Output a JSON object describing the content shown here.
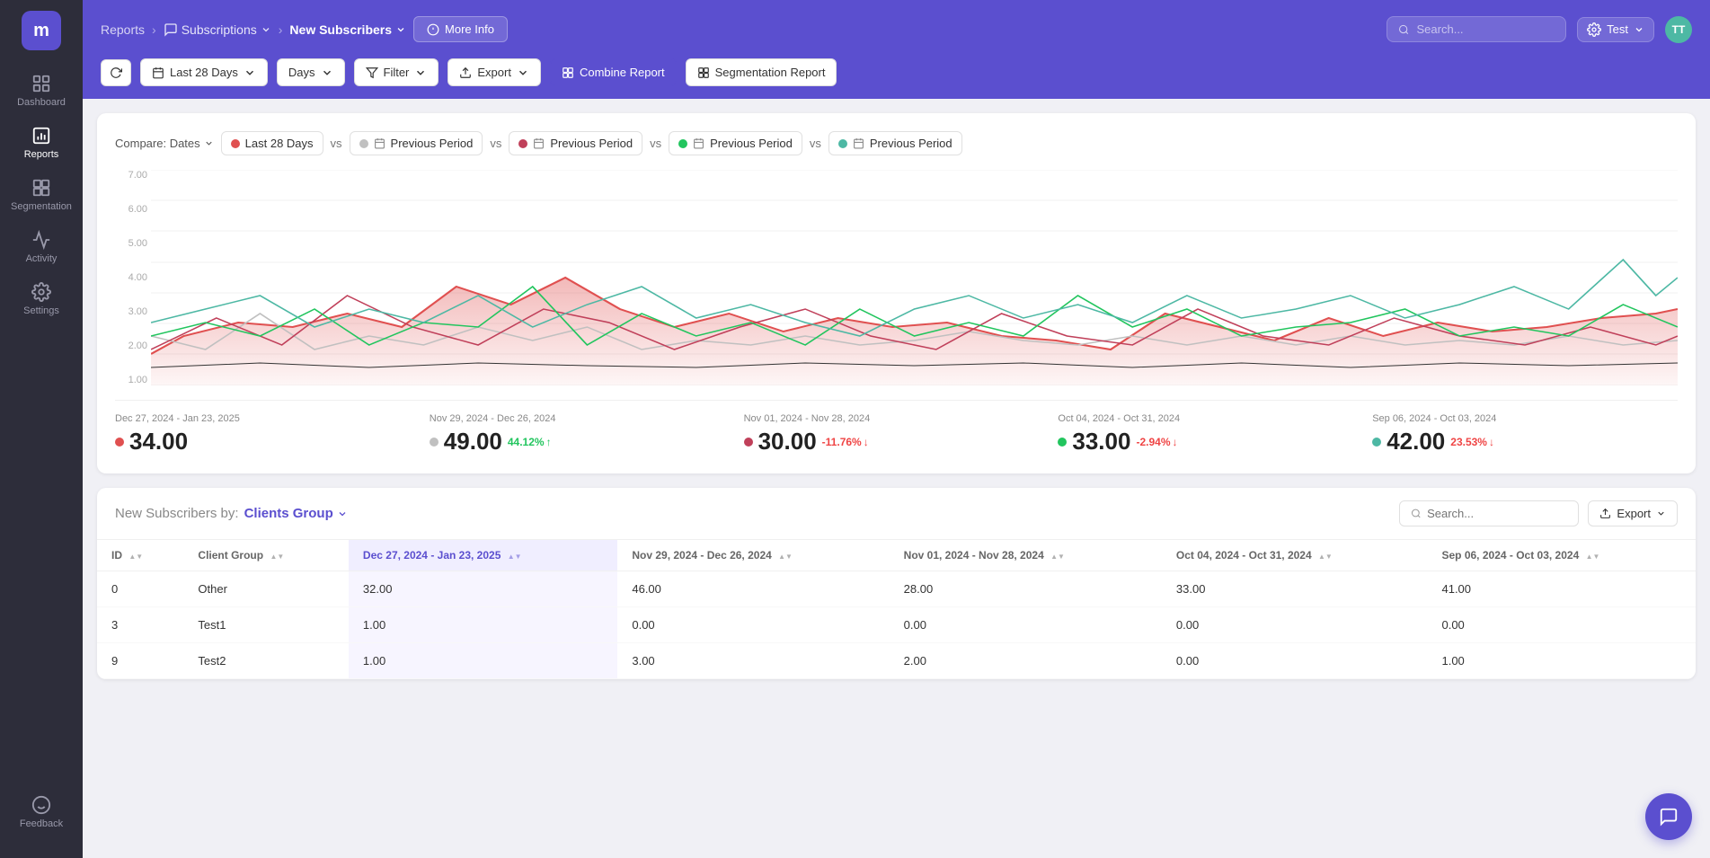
{
  "sidebar": {
    "logo": "m",
    "items": [
      {
        "id": "dashboard",
        "label": "Dashboard",
        "icon": "dashboard"
      },
      {
        "id": "reports",
        "label": "Reports",
        "icon": "reports",
        "active": true
      },
      {
        "id": "segmentation",
        "label": "Segmentation",
        "icon": "segmentation"
      },
      {
        "id": "activity",
        "label": "Activity",
        "icon": "activity"
      },
      {
        "id": "settings",
        "label": "Settings",
        "icon": "settings"
      }
    ],
    "feedback_label": "Feedback"
  },
  "header": {
    "breadcrumb": {
      "reports": "Reports",
      "subscriptions": "Subscriptions",
      "current": "New Subscribers"
    },
    "more_info": "More Info",
    "search_placeholder": "Search...",
    "user_name": "Test",
    "user_initials": "TT"
  },
  "toolbar": {
    "days_label": "Days",
    "date_range": "Last 28 Days",
    "filter_label": "Filter",
    "export_label": "Export",
    "combine_report": "Combine Report",
    "segmentation_report": "Segmentation Report"
  },
  "chart": {
    "compare_label": "Compare: Dates",
    "series": [
      {
        "id": "s1",
        "label": "Last 28 Days",
        "color": "#e05050",
        "dot_color": "#e05050"
      },
      {
        "id": "s2",
        "label": "Previous Period",
        "color": "#c0c0c0",
        "dot_color": "#c0c0c0"
      },
      {
        "id": "s3",
        "label": "Previous Period",
        "color": "#c0405a",
        "dot_color": "#c0405a"
      },
      {
        "id": "s4",
        "label": "Previous Period",
        "color": "#22c55e",
        "dot_color": "#22c55e"
      },
      {
        "id": "s5",
        "label": "Previous Period",
        "color": "#4db8a4",
        "dot_color": "#4db8a4"
      }
    ],
    "y_labels": [
      "7.00",
      "6.00",
      "5.00",
      "4.00",
      "3.00",
      "2.00",
      "1.00"
    ],
    "periods": [
      {
        "date_range": "Dec 27, 2024 - Jan 23, 2025",
        "value": "34.00",
        "change": null,
        "dot_color": "#e05050"
      },
      {
        "date_range": "Nov 29, 2024 - Dec 26, 2024",
        "value": "49.00",
        "change": "44.12%",
        "change_dir": "up",
        "dot_color": "#c0c0c0"
      },
      {
        "date_range": "Nov 01, 2024 - Nov 28, 2024",
        "value": "30.00",
        "change": "-11.76%",
        "change_dir": "down",
        "dot_color": "#c0405a"
      },
      {
        "date_range": "Oct 04, 2024 - Oct 31, 2024",
        "value": "33.00",
        "change": "-2.94%",
        "change_dir": "down",
        "dot_color": "#22c55e"
      },
      {
        "date_range": "Sep 06, 2024 - Oct 03, 2024",
        "value": "42.00",
        "change": "23.53%",
        "change_dir": "down",
        "dot_color": "#4db8a4"
      }
    ]
  },
  "table": {
    "title": "New Subscribers by:",
    "group_label": "Clients Group",
    "search_placeholder": "Search...",
    "export_label": "Export",
    "columns": [
      {
        "id": "id",
        "label": "ID"
      },
      {
        "id": "client_group",
        "label": "Client Group"
      },
      {
        "id": "dec27_jan23",
        "label": "Dec 27, 2024 - Jan 23, 2025",
        "active": true
      },
      {
        "id": "nov29_dec26",
        "label": "Nov 29, 2024 - Dec 26, 2024"
      },
      {
        "id": "nov01_nov28",
        "label": "Nov 01, 2024 - Nov 28, 2024"
      },
      {
        "id": "oct04_oct31",
        "label": "Oct 04, 2024 - Oct 31, 2024"
      },
      {
        "id": "sep06_oct03",
        "label": "Sep 06, 2024 - Oct 03, 2024"
      }
    ],
    "rows": [
      {
        "id": "0",
        "client_group": "Other",
        "dec27": "32.00",
        "nov29": "46.00",
        "nov01": "28.00",
        "oct04": "33.00",
        "sep06": "41.00"
      },
      {
        "id": "3",
        "client_group": "Test1",
        "dec27": "1.00",
        "nov29": "0.00",
        "nov01": "0.00",
        "oct04": "0.00",
        "sep06": "0.00"
      },
      {
        "id": "9",
        "client_group": "Test2",
        "dec27": "1.00",
        "nov29": "3.00",
        "nov01": "2.00",
        "oct04": "0.00",
        "sep06": "1.00"
      }
    ]
  }
}
